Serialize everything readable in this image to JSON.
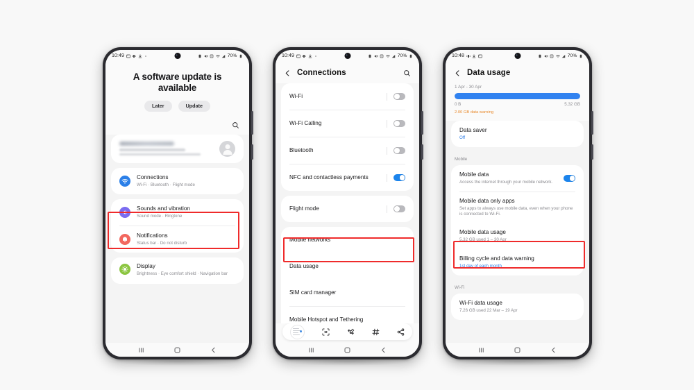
{
  "page": {
    "background": "#f8f8f8",
    "accent_blue": "#1b84ec",
    "highlight_red": "#ef2b2b",
    "warning_orange": "#e8892b"
  },
  "phone1": {
    "status": {
      "time": "10:49",
      "battery": "70%",
      "icons": [
        "image-icon",
        "vibrate-icon",
        "download-icon",
        "dot-icon"
      ],
      "right_icons": [
        "alarm-icon",
        "mute-icon",
        "nfc-icon",
        "wifi-icon",
        "signal-icon"
      ]
    },
    "update": {
      "title": "A software update is available",
      "later_label": "Later",
      "update_label": "Update"
    },
    "search_icon": "search-icon",
    "items": [
      {
        "title": "Connections",
        "subtitle": "Wi-Fi  ·  Bluetooth  ·  Flight mode",
        "icon": "wifi-icon",
        "color": "#2b7fe8",
        "highlighted": true
      },
      {
        "title": "Sounds and vibration",
        "subtitle": "Sound mode  ·  Ringtone",
        "icon": "speaker-icon",
        "color": "#7b6cf0",
        "highlighted": false
      },
      {
        "title": "Notifications",
        "subtitle": "Status bar  ·  Do not disturb",
        "icon": "bell-icon",
        "color": "#f2675f",
        "highlighted": false
      },
      {
        "title": "Display",
        "subtitle": "Brightness  ·  Eye comfort shield  ·  Navigation bar",
        "icon": "brightness-icon",
        "color": "#8bc53f",
        "highlighted": false
      }
    ]
  },
  "phone2": {
    "status": {
      "time": "10:49",
      "battery": "70%"
    },
    "appbar": {
      "title": "Connections",
      "back_icon": "back-arrow-icon",
      "search_icon": "search-icon"
    },
    "toggles": [
      {
        "label": "Wi-Fi",
        "on": false
      },
      {
        "label": "Wi-Fi Calling",
        "on": false
      },
      {
        "label": "Bluetooth",
        "on": false
      },
      {
        "label": "NFC and contactless payments",
        "on": true
      }
    ],
    "flight": {
      "label": "Flight mode",
      "on": false
    },
    "links": [
      {
        "label": "Mobile networks",
        "highlighted": false
      },
      {
        "label": "Data usage",
        "highlighted": true
      },
      {
        "label": "SIM card manager",
        "highlighted": false
      },
      {
        "label": "Mobile Hotspot and Tethering",
        "highlighted": false
      }
    ],
    "shotbar_icons": [
      "screenshot-thumbnail",
      "scroll-capture-icon",
      "crop-icon",
      "markup-icon",
      "tags-icon",
      "share-icon"
    ]
  },
  "phone3": {
    "status": {
      "time": "10:48",
      "battery": "70%"
    },
    "appbar": {
      "title": "Data usage",
      "back_icon": "back-arrow-icon"
    },
    "usage": {
      "period": "1 Apr - 30 Apr",
      "bar_percent": 100,
      "min_label": "0 B",
      "max_label": "5.32 GB",
      "warning": "2.00 GB data warning"
    },
    "data_saver": {
      "title": "Data saver",
      "value": "Off"
    },
    "section_mobile": "Mobile",
    "mobile_data": {
      "title": "Mobile data",
      "subtitle": "Access the internet through your mobile network.",
      "on": true
    },
    "mobile_only_apps": {
      "title": "Mobile data only apps",
      "subtitle": "Set apps to always use mobile data, even when your phone is connected to Wi-Fi."
    },
    "mobile_data_usage": {
      "title": "Mobile data usage",
      "subtitle": "5.32 GB used 1 – 30 Apr",
      "highlighted": true
    },
    "billing": {
      "title": "Billing cycle and data warning",
      "subtitle": "1st day of each month"
    },
    "section_wifi": "Wi-Fi",
    "wifi_usage": {
      "title": "Wi-Fi data usage",
      "subtitle": "7.26 GB used 22 Mar – 19 Apr"
    }
  },
  "navbar": {
    "recents_icon": "recents-icon",
    "home_icon": "home-icon",
    "back_icon": "back-icon"
  }
}
